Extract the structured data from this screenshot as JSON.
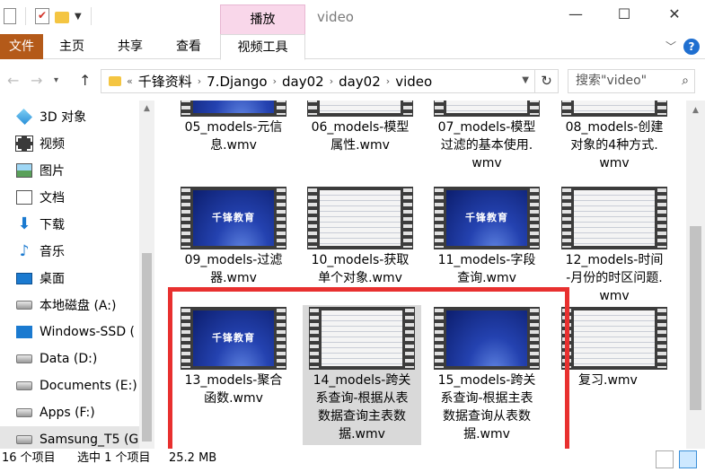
{
  "window": {
    "title": "video",
    "context_tab": "播放",
    "minimize": "—",
    "maximize": "☐",
    "close": "✕"
  },
  "ribbon": {
    "tabs": [
      "文件",
      "主页",
      "共享",
      "查看",
      "视频工具"
    ],
    "file_color": "#b45a19",
    "help": "?"
  },
  "address": {
    "prefix": "«",
    "crumbs": [
      "千锋资料",
      "7.Django",
      "day02",
      "day02",
      "video"
    ],
    "search_placeholder": "搜索\"video\""
  },
  "sidebar": {
    "items": [
      {
        "label": "3D 对象",
        "icon": "cube-icon"
      },
      {
        "label": "视频",
        "icon": "film-icon"
      },
      {
        "label": "图片",
        "icon": "picture-icon"
      },
      {
        "label": "文档",
        "icon": "document-icon"
      },
      {
        "label": "下载",
        "icon": "download-icon"
      },
      {
        "label": "音乐",
        "icon": "music-icon"
      },
      {
        "label": "桌面",
        "icon": "desktop-icon"
      },
      {
        "label": "本地磁盘 (A:)",
        "icon": "drive-icon"
      },
      {
        "label": "Windows-SSD (",
        "icon": "windows-drive-icon"
      },
      {
        "label": "Data (D:)",
        "icon": "drive-icon"
      },
      {
        "label": "Documents (E:)",
        "icon": "drive-icon"
      },
      {
        "label": "Apps (F:)",
        "icon": "drive-icon"
      },
      {
        "label": "Samsung_T5 (G",
        "icon": "drive-icon"
      }
    ]
  },
  "files": [
    {
      "name": "05_models-元信息.wmv",
      "lines": [
        "05_models-元信",
        "息.wmv"
      ],
      "thumb": "blue"
    },
    {
      "name": "06_models-模型属性.wmv",
      "lines": [
        "06_models-模型",
        "属性.wmv"
      ],
      "thumb": "code"
    },
    {
      "name": "07_models-模型过滤的基本使用.wmv",
      "lines": [
        "07_models-模型",
        "过滤的基本使用.",
        "wmv"
      ],
      "thumb": "code"
    },
    {
      "name": "08_models-创建对象的4种方式.wmv",
      "lines": [
        "08_models-创建",
        "对象的4种方式.",
        "wmv"
      ],
      "thumb": "code"
    },
    {
      "name": "09_models-过滤器.wmv",
      "lines": [
        "09_models-过滤",
        "器.wmv"
      ],
      "thumb": "blue"
    },
    {
      "name": "10_models-获取单个对象.wmv",
      "lines": [
        "10_models-获取",
        "单个对象.wmv"
      ],
      "thumb": "code"
    },
    {
      "name": "11_models-字段查询.wmv",
      "lines": [
        "11_models-字段",
        "查询.wmv"
      ],
      "thumb": "blue"
    },
    {
      "name": "12_models-时间-月份的时区问题.wmv",
      "lines": [
        "12_models-时间",
        "-月份的时区问题.",
        "wmv"
      ],
      "thumb": "code"
    },
    {
      "name": "13_models-聚合函数.wmv",
      "lines": [
        "13_models-聚合",
        "函数.wmv"
      ],
      "thumb": "blue"
    },
    {
      "name": "14_models-跨关系查询-根据从表数据查询主表数据.wmv",
      "lines": [
        "14_models-跨关",
        "系查询-根据从表",
        "数据查询主表数",
        "据.wmv"
      ],
      "thumb": "code",
      "selected": true
    },
    {
      "name": "15_models-跨关系查询-根据主表数据查询从表数据.wmv",
      "lines": [
        "15_models-跨关",
        "系查询-根据主表",
        "数据查询从表数",
        "据.wmv"
      ],
      "thumb": "blue"
    },
    {
      "name": "复习.wmv",
      "lines": [
        "复习.wmv"
      ],
      "thumb": "code"
    }
  ],
  "thumb_brand": "千锋教育",
  "status": {
    "count": "16 个项目",
    "selected": "选中 1 个项目",
    "size": "25.2 MB"
  }
}
